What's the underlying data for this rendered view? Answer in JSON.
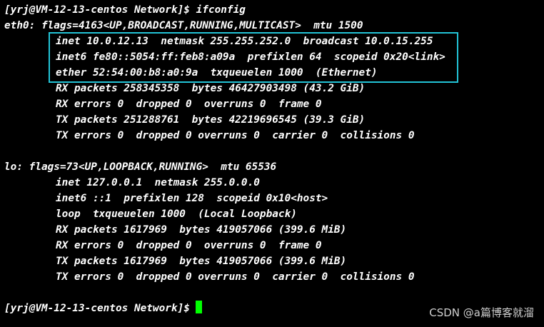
{
  "terminal": {
    "prompt_1": "[yrj@VM-12-13-centos Network]$ ifconfig",
    "eth0": {
      "header": "eth0: flags=4163<UP,BROADCAST,RUNNING,MULTICAST>  mtu 1500",
      "inet": "inet 10.0.12.13  netmask 255.255.252.0  broadcast 10.0.15.255",
      "inet6": "inet6 fe80::5054:ff:feb8:a09a  prefixlen 64  scopeid 0x20<link>",
      "ether": "ether 52:54:00:b8:a0:9a  txqueuelen 1000  (Ethernet)",
      "rx_packets": "RX packets 258345358  bytes 46427903498 (43.2 GiB)",
      "rx_errors": "RX errors 0  dropped 0  overruns 0  frame 0",
      "tx_packets": "TX packets 251288761  bytes 42219696545 (39.3 GiB)",
      "tx_errors": "TX errors 0  dropped 0 overruns 0  carrier 0  collisions 0"
    },
    "lo": {
      "header": "lo: flags=73<UP,LOOPBACK,RUNNING>  mtu 65536",
      "inet": "inet 127.0.0.1  netmask 255.0.0.0",
      "inet6": "inet6 ::1  prefixlen 128  scopeid 0x10<host>",
      "loop": "loop  txqueuelen 1000  (Local Loopback)",
      "rx_packets": "RX packets 1617969  bytes 419057066 (399.6 MiB)",
      "rx_errors": "RX errors 0  dropped 0  overruns 0  frame 0",
      "tx_packets": "TX packets 1617969  bytes 419057066 (399.6 MiB)",
      "tx_errors": "TX errors 0  dropped 0 overruns 0  carrier 0  collisions 0"
    },
    "prompt_2": "[yrj@VM-12-13-centos Network]$"
  },
  "watermark": "CSDN @a篇博客就溜",
  "colors": {
    "background": "#000000",
    "text": "#ffffff",
    "cursor": "#00ff00",
    "highlight_border": "#22c3d6"
  }
}
